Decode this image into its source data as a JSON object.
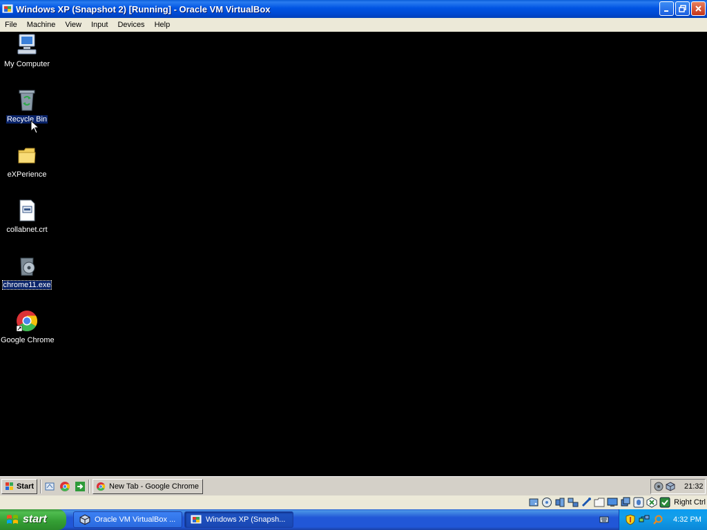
{
  "window": {
    "title": "Windows XP (Snapshot 2) [Running] - Oracle VM VirtualBox",
    "icon": "virtualbox-vm-icon",
    "controls": [
      "minimize",
      "restore",
      "close"
    ]
  },
  "menubar": {
    "items": [
      "File",
      "Machine",
      "View",
      "Input",
      "Devices",
      "Help"
    ]
  },
  "desktop": {
    "icons": [
      {
        "label": "My Computer",
        "icon": "my-computer-icon",
        "state": "normal"
      },
      {
        "label": "Recycle Bin",
        "icon": "recycle-bin-icon",
        "state": "selected"
      },
      {
        "label": "eXPerience",
        "icon": "folder-icon",
        "state": "normal"
      },
      {
        "label": "collabnet.crt",
        "icon": "certificate-file-icon",
        "state": "normal"
      },
      {
        "label": "chrome11.exe",
        "icon": "installer-icon",
        "state": "focused"
      },
      {
        "label": "Google Chrome",
        "icon": "chrome-icon",
        "state": "normal"
      }
    ]
  },
  "guest_taskbar": {
    "start_label": "Start",
    "quick_launch": [
      "show-desktop-icon",
      "chrome-icon",
      "arrow-icon"
    ],
    "tasks": [
      {
        "label": "New Tab - Google Chrome",
        "icon": "chrome-icon"
      }
    ],
    "tray_icons": [
      "network-icon",
      "virtualbox-icon"
    ],
    "clock": "21:32"
  },
  "statusbar": {
    "icons": [
      "hard-disk-icon",
      "optical-drive-icon",
      "audio-icon",
      "network-adapter-icon",
      "usb-icon",
      "shared-folders-icon",
      "display-icon",
      "capture-icon",
      "mouse-integration-icon",
      "cpu-icon",
      "keyboard-capture-icon"
    ],
    "host_key": "Right Ctrl"
  },
  "host_taskbar": {
    "start_label": "start",
    "tasks": [
      {
        "label": "Oracle VM VirtualBox ...",
        "icon": "virtualbox-icon",
        "active": false
      },
      {
        "label": "Windows XP (Snapsh...",
        "icon": "windows-xp-icon",
        "active": true
      }
    ],
    "tray_icons": [
      "security-shield-icon",
      "network-icon",
      "search-icon"
    ],
    "clock": "4:32 PM"
  }
}
